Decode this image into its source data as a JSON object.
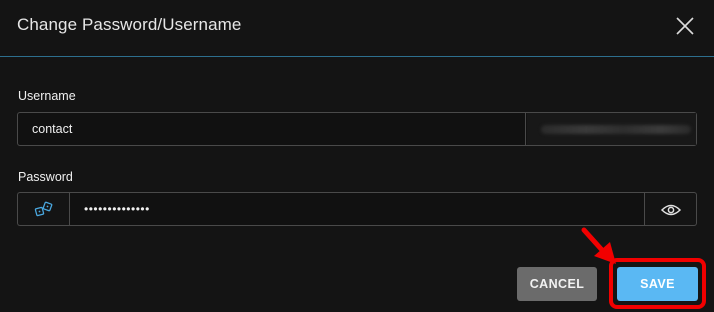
{
  "dialog": {
    "title": "Change Password/Username"
  },
  "username": {
    "label": "Username",
    "value": "contact",
    "suffix": ""
  },
  "password": {
    "label": "Password",
    "value": "••••••••••••••"
  },
  "buttons": {
    "cancel_label": "CANCEL",
    "save_label": "SAVE"
  },
  "icons": {
    "close": "close-icon",
    "generate": "dice-icon",
    "reveal": "eye-icon",
    "annotation": "red-arrow"
  },
  "colors": {
    "accent": "#5ab8f3",
    "highlight": "#f20000",
    "cancel": "#6b6b6b",
    "divider": "#2d6f8e"
  }
}
